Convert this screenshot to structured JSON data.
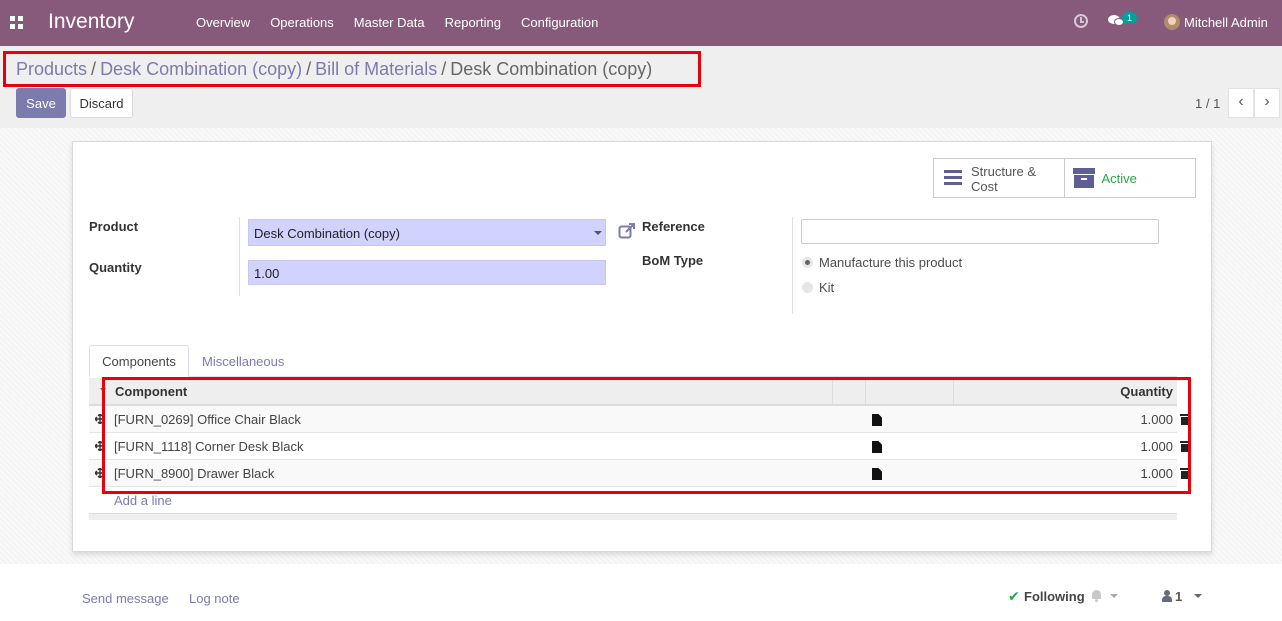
{
  "navbar": {
    "app_title": "Inventory",
    "menu": [
      "Overview",
      "Operations",
      "Master Data",
      "Reporting",
      "Configuration"
    ],
    "messages_count": "1",
    "user_name": "Mitchell Admin"
  },
  "breadcrumb": {
    "items": [
      "Products",
      "Desk Combination (copy)",
      "Bill of Materials"
    ],
    "separator": "/",
    "current": "Desk Combination (copy)"
  },
  "toolbar": {
    "save_label": "Save",
    "discard_label": "Discard",
    "pager": "1 / 1",
    "prev_glyph": "‹",
    "next_glyph": "›"
  },
  "smart_buttons": {
    "structure_label_1": "Structure &",
    "structure_label_2": "Cost",
    "active_label": "Active"
  },
  "form": {
    "product_label": "Product",
    "product_value": "Desk Combination (copy)",
    "quantity_label": "Quantity",
    "quantity_value": "1.00",
    "reference_label": "Reference",
    "reference_value": "",
    "bom_type_label": "BoM Type",
    "bom_type_options": [
      "Manufacture this product",
      "Kit"
    ],
    "bom_type_selected": "Manufacture this product"
  },
  "tabs": [
    "Components",
    "Miscellaneous"
  ],
  "components_table": {
    "headers": {
      "component": "Component",
      "quantity": "Quantity"
    },
    "rows": [
      {
        "component": "[FURN_0269] Office Chair Black",
        "quantity": "1.000"
      },
      {
        "component": "[FURN_1118] Corner Desk Black",
        "quantity": "1.000"
      },
      {
        "component": "[FURN_8900] Drawer Black",
        "quantity": "1.000"
      }
    ],
    "add_line_label": "Add a line"
  },
  "chatter": {
    "send_message": "Send message",
    "log_note": "Log note",
    "following": "Following",
    "check_glyph": "✔",
    "followers_count": "1"
  },
  "colors": {
    "navbar": "#875a7b",
    "primary": "#7c7bad",
    "highlight_box": "#e8000b",
    "active_green": "#28a745",
    "required_field": "#d2d2ff"
  }
}
